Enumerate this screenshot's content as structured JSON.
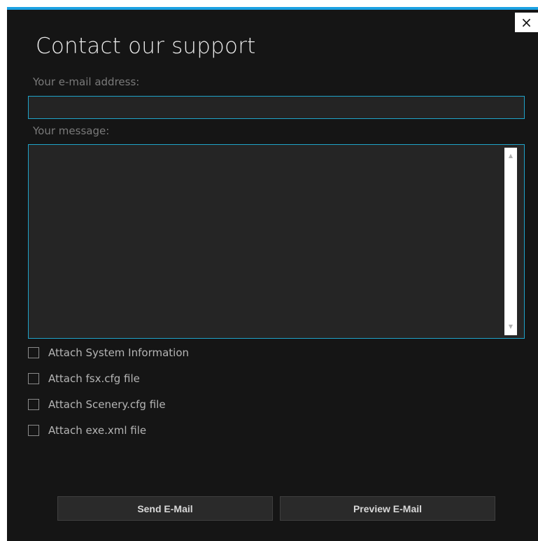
{
  "dialog": {
    "title": "Contact our support",
    "close_label": "×",
    "accent_color": "#1ba1e2"
  },
  "email": {
    "label": "Your e-mail address:",
    "value": "",
    "placeholder": ""
  },
  "message": {
    "label": "Your message:",
    "value": ""
  },
  "attachments": [
    {
      "label": "Attach System Information",
      "checked": false
    },
    {
      "label": "Attach fsx.cfg file",
      "checked": false
    },
    {
      "label": "Attach Scenery.cfg file",
      "checked": false
    },
    {
      "label": "Attach exe.xml file",
      "checked": false
    }
  ],
  "buttons": {
    "send_label": "Send E-Mail",
    "preview_label": "Preview E-Mail"
  },
  "icons": {
    "close": "close-icon",
    "scroll_up": "chevron-up-icon",
    "scroll_down": "chevron-down-icon"
  }
}
